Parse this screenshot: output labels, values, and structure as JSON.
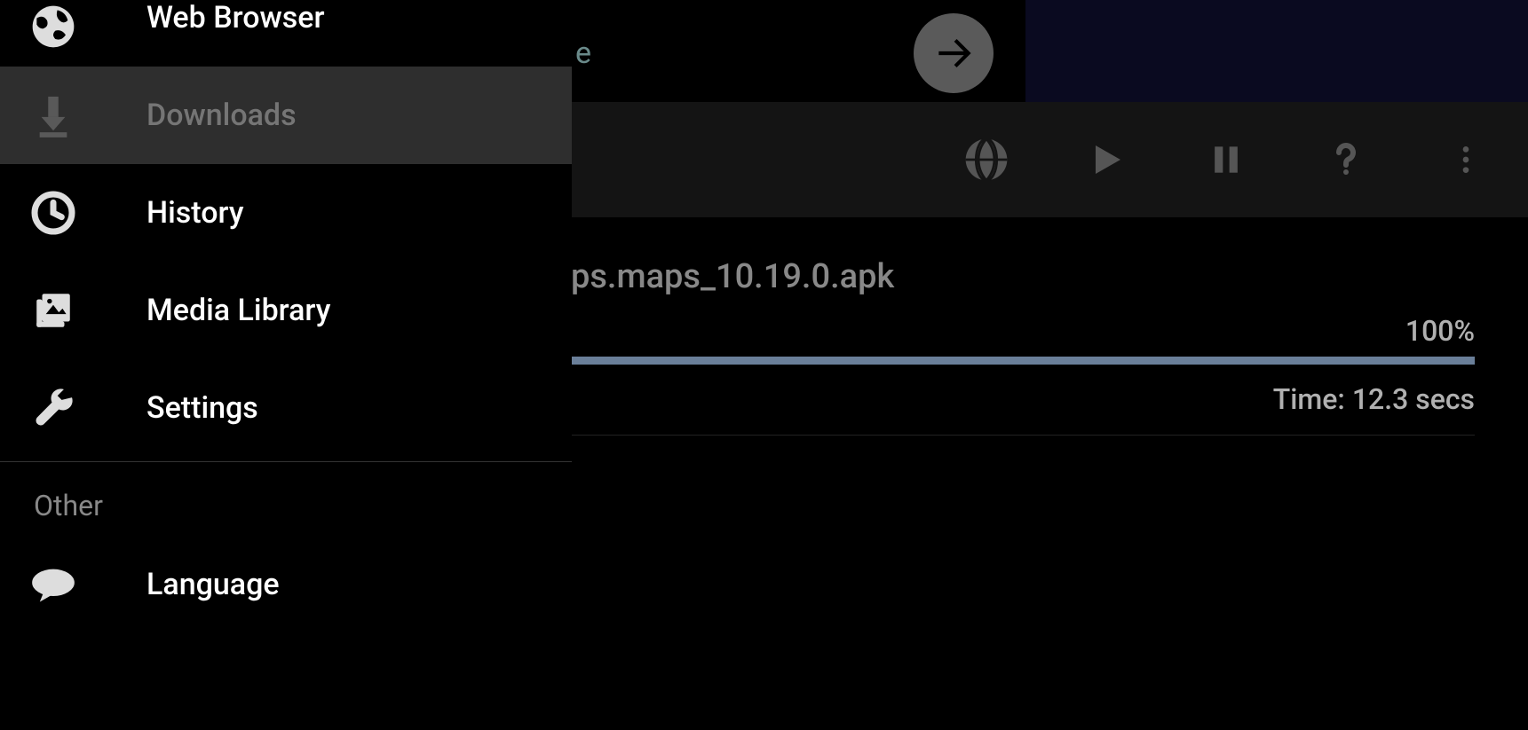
{
  "drawer": {
    "items": [
      {
        "label": "Web Browser",
        "icon": "globe"
      },
      {
        "label": "Downloads",
        "icon": "download",
        "selected": true
      },
      {
        "label": "History",
        "icon": "clock"
      },
      {
        "label": "Media Library",
        "icon": "media"
      },
      {
        "label": "Settings",
        "icon": "wrench"
      }
    ],
    "section_label": "Other",
    "other_items": [
      {
        "label": "Language",
        "icon": "chat"
      }
    ]
  },
  "url_hint_fragment": "e",
  "toolbar": {
    "icons": [
      "globe",
      "play",
      "pause",
      "help",
      "overflow"
    ]
  },
  "download": {
    "filename": "ps.maps_10.19.0.apk",
    "percent": "100%",
    "time": "Time: 12.3 secs"
  }
}
